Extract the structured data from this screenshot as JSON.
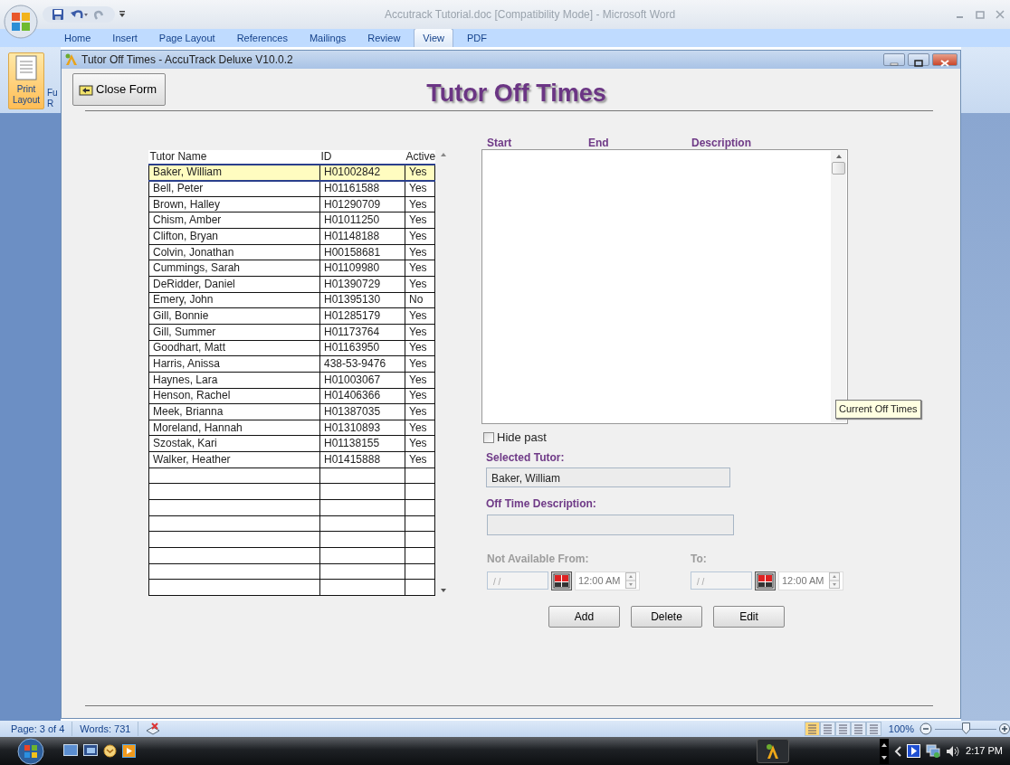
{
  "word_window": {
    "title": "Accutrack Tutorial.doc [Compatibility Mode] - Microsoft Word"
  },
  "ribbon_tabs": [
    {
      "label": "Home",
      "selected": false
    },
    {
      "label": "Insert",
      "selected": false
    },
    {
      "label": "Page Layout",
      "selected": false
    },
    {
      "label": "References",
      "selected": false
    },
    {
      "label": "Mailings",
      "selected": false
    },
    {
      "label": "Review",
      "selected": false
    },
    {
      "label": "View",
      "selected": true
    },
    {
      "label": "PDF",
      "selected": false
    }
  ],
  "ribbon_buttons": [
    {
      "lines": [
        "Print",
        "Layout"
      ],
      "selected": true
    },
    {
      "lines": [
        "Fu",
        "R"
      ],
      "selected": false
    }
  ],
  "form": {
    "title": "Tutor Off Times - AccuTrack Deluxe V10.0.2",
    "close_button": "Close Form",
    "heading": "Tutor Off Times",
    "tutor_table": {
      "columns": [
        "Tutor Name",
        "ID",
        "Active"
      ],
      "rows": [
        {
          "cells": [
            "Baker, William",
            "H01002842",
            "Yes"
          ],
          "selected": true
        },
        {
          "cells": [
            "Bell, Peter",
            "H01161588",
            "Yes"
          ],
          "selected": false
        },
        {
          "cells": [
            "Brown, Halley",
            "H01290709",
            "Yes"
          ],
          "selected": false
        },
        {
          "cells": [
            "Chism, Amber",
            "H01011250",
            "Yes"
          ],
          "selected": false
        },
        {
          "cells": [
            "Clifton, Bryan",
            "H01148188",
            "Yes"
          ],
          "selected": false
        },
        {
          "cells": [
            "Colvin, Jonathan",
            "H00158681",
            "Yes"
          ],
          "selected": false
        },
        {
          "cells": [
            "Cummings, Sarah",
            "H01109980",
            "Yes"
          ],
          "selected": false
        },
        {
          "cells": [
            "DeRidder, Daniel",
            "H01390729",
            "Yes"
          ],
          "selected": false
        },
        {
          "cells": [
            "Emery, John",
            "H01395130",
            "No"
          ],
          "selected": false
        },
        {
          "cells": [
            "Gill, Bonnie",
            "H01285179",
            "Yes"
          ],
          "selected": false
        },
        {
          "cells": [
            "Gill, Summer",
            "H01173764",
            "Yes"
          ],
          "selected": false
        },
        {
          "cells": [
            "Goodhart, Matt",
            "H01163950",
            "Yes"
          ],
          "selected": false
        },
        {
          "cells": [
            "Harris, Anissa",
            "438-53-9476",
            "Yes"
          ],
          "selected": false
        },
        {
          "cells": [
            "Haynes, Lara",
            "H01003067",
            "Yes"
          ],
          "selected": false
        },
        {
          "cells": [
            "Henson, Rachel",
            "H01406366",
            "Yes"
          ],
          "selected": false
        },
        {
          "cells": [
            "Meek, Brianna",
            "H01387035",
            "Yes"
          ],
          "selected": false
        },
        {
          "cells": [
            "Moreland, Hannah",
            "H01310893",
            "Yes"
          ],
          "selected": false
        },
        {
          "cells": [
            "Szostak, Kari",
            "H01138155",
            "Yes"
          ],
          "selected": false
        },
        {
          "cells": [
            "Walker, Heather",
            "H01415888",
            "Yes"
          ],
          "selected": false
        }
      ]
    },
    "off_times": {
      "columns": [
        "Start",
        "End",
        "Description"
      ],
      "tooltip": "Current Off Times"
    },
    "hide_past": {
      "label": "Hide past",
      "checked": false
    },
    "selected_tutor": {
      "label": "Selected Tutor:",
      "value": "Baker, William"
    },
    "description": {
      "label": "Off Time Description:"
    },
    "from": {
      "label": "Not Available From:",
      "date": "/ /",
      "time": "12:00 AM",
      "disabled": true
    },
    "to": {
      "label": "To:",
      "date": "/ /",
      "time": "12:00 AM",
      "disabled": true
    },
    "buttons": [
      "Add",
      "Delete",
      "Edit"
    ]
  },
  "status_bar": {
    "page": "Page: 3 of 4",
    "words": "Words: 731",
    "zoom": "100%"
  },
  "taskbar": {
    "time": "2:17 PM"
  }
}
